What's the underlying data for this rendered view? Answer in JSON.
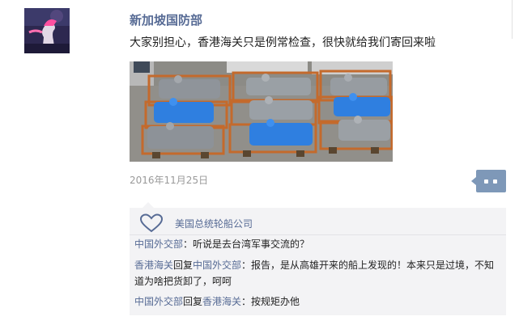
{
  "post": {
    "author": "新加坡国防部",
    "text": "大家别担心，香港海关只是例常检查，很快就给我们寄回来啦",
    "date": "2016年11月25日"
  },
  "likes": {
    "icon": "heart-outline-icon",
    "users": [
      "美国总统轮船公司"
    ]
  },
  "comments": [
    {
      "author": "中国外交部",
      "text": "：听说是去台湾军事交流的？"
    },
    {
      "author": "香港海关",
      "reply_word": "回复",
      "reply_to": "中国外交部",
      "text": "：报告，是从高雄开来的船上发现的！本来只是过境，不知道为啥把货卸了，呵呵"
    },
    {
      "author": "中国外交部",
      "reply_word": "回复",
      "reply_to": "香港海关",
      "text": "：按规矩办他"
    }
  ],
  "colors": {
    "link": "#576b95",
    "panel_bg": "#f3f3f5",
    "comment_button": "#7e98b8",
    "tarp_blue": "#2f7fe0",
    "tarp_gray": "#8d9298",
    "rails_orange": "#c46a2c"
  },
  "icons": {
    "comment_button": "comment-dots-icon",
    "avatar": "merlion-avatar"
  }
}
